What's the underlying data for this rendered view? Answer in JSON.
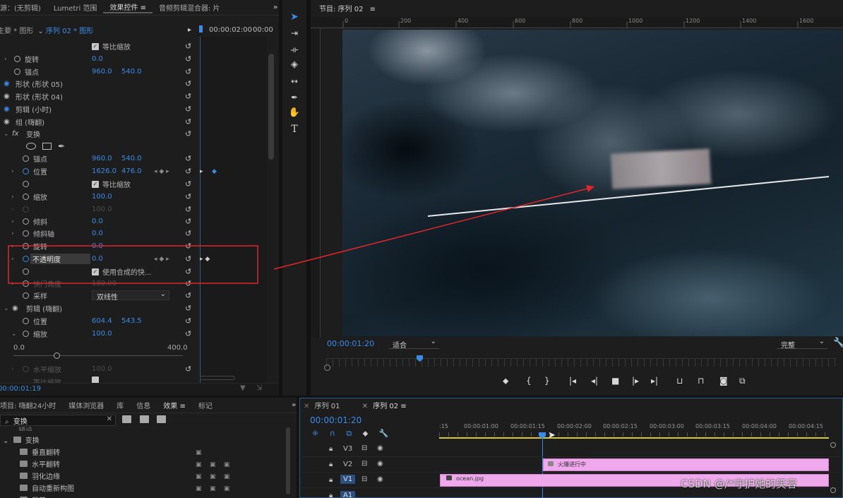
{
  "left_tabs": [
    "源：(无剪辑)",
    "Lumetri 范围",
    "效果控件",
    "音频剪辑混合器: 片"
  ],
  "left_tab_more": "»",
  "ec": {
    "source": "主要 * 图形",
    "sequence": "序列 02 * 图形",
    "tc1": "00:00:02:00",
    "tc2": "00:00",
    "time": "00:00:01:19",
    "scale_min": "0.0",
    "scale_max": "400.0",
    "rows": [
      {
        "label": "",
        "v1": "",
        "v2": "",
        "check": "等比缩放"
      },
      {
        "label": "旋转",
        "v1": "0.0",
        "v2": ""
      },
      {
        "label": "锚点",
        "v1": "960.0",
        "v2": "540.0"
      },
      {
        "label": "形状 (形状 05)",
        "v1": "",
        "v2": ""
      },
      {
        "label": "形状 (形状 04)",
        "v1": "",
        "v2": ""
      },
      {
        "label": "剪辑 (小时)",
        "v1": "",
        "v2": ""
      },
      {
        "label": "组 (嗨翻)",
        "v1": "",
        "v2": ""
      },
      {
        "label": "变换",
        "v1": "",
        "v2": ""
      },
      {
        "label": "",
        "v1": "",
        "v2": ""
      },
      {
        "label": "锚点",
        "v1": "960.0",
        "v2": "540.0"
      },
      {
        "label": "位置",
        "v1": "1626.0",
        "v2": "476.0"
      },
      {
        "label": "",
        "v1": "",
        "v2": "",
        "check": "等比缩放"
      },
      {
        "label": "缩放",
        "v1": "100.0",
        "v2": ""
      },
      {
        "label": "",
        "v1": "100.0",
        "v2": ""
      },
      {
        "label": "倾斜",
        "v1": "0.0",
        "v2": ""
      },
      {
        "label": "倾斜轴",
        "v1": "0.0",
        "v2": ""
      },
      {
        "label": "旋转",
        "v1": "0.0",
        "v2": ""
      },
      {
        "label": "不透明度",
        "v1": "0.0",
        "v2": ""
      },
      {
        "label": "",
        "v1": "",
        "v2": "",
        "check": "使用合成的快..."
      },
      {
        "label": "快门角度",
        "v1": "180.00",
        "v2": ""
      },
      {
        "label": "采样",
        "v1": "双线性",
        "v2": ""
      },
      {
        "label": "剪辑 (嗨翻)",
        "v1": "",
        "v2": ""
      },
      {
        "label": "位置",
        "v1": "604.4",
        "v2": "543.5"
      },
      {
        "label": "缩放",
        "v1": "100.0",
        "v2": ""
      },
      {
        "label": "",
        "v1": "",
        "v2": ""
      },
      {
        "label": "",
        "v1": "",
        "v2": ""
      },
      {
        "label": "水平缩放",
        "v1": "100.0",
        "v2": ""
      },
      {
        "label": "等比缩放",
        "v1": "",
        "v2": ""
      }
    ]
  },
  "program": {
    "title": "节目: 序列 02",
    "menu": "≡",
    "ruler": [
      "0",
      "200",
      "400",
      "600",
      "800",
      "1000",
      "1200",
      "1400",
      "1600"
    ],
    "timecode": "00:00:01:20",
    "fit": "适合",
    "quality": "完整"
  },
  "tools": [
    "selection-tool",
    "track-select-tool",
    "ripple-edit-tool",
    "razor-tool",
    "slip-tool",
    "pen-tool",
    "hand-tool",
    "type-tool"
  ],
  "bottom_tabs": [
    "项目: 嗨翻24小时",
    "媒体浏览器",
    "库",
    "信息",
    "效果",
    "标记"
  ],
  "effects": {
    "search": "变换",
    "folder": "变换",
    "partial_top": "预设",
    "items": [
      "垂直翻转",
      "水平翻转",
      "羽化边缘",
      "自动重新构图",
      "裁剪"
    ]
  },
  "timeline": {
    "tabs": [
      "序列 01",
      "序列 02"
    ],
    "timecode": "00:00:01:20",
    "ruler": [
      ":15",
      "00:00:01:00",
      "00:00:01:15",
      "00:00:02:00",
      "00:00:02:15",
      "00:00:03:00",
      "00:00:03:15",
      "00:00:04:00",
      "00:00:04:15"
    ],
    "tracks": [
      "V3",
      "V2",
      "V1",
      "A1"
    ],
    "clip_v2": "火爆进行中",
    "clip_v1": "ocean.jpg"
  },
  "watermark": "CSDN @/*守护她的笑容",
  "colors": {
    "accent": "#3a8be8",
    "clip": "#f0a8ec",
    "annotation": "#e0262a"
  }
}
